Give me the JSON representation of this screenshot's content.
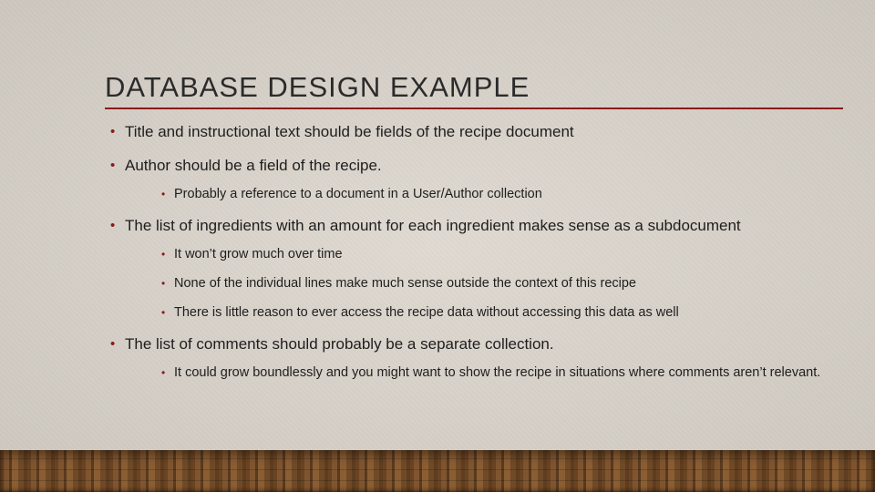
{
  "title": "DATABASE DESIGN EXAMPLE",
  "bullets": [
    {
      "text": "Title and instructional text should be fields of the recipe document",
      "sub": []
    },
    {
      "text": "Author should be a field of the recipe.",
      "sub": [
        "Probably a reference to a document in a User/Author collection"
      ]
    },
    {
      "text": "The list of ingredients with an amount for each ingredient makes sense as a subdocument",
      "sub": [
        "It won’t grow much over time",
        "None of the individual lines make much sense outside the context of this recipe",
        "There is little reason to ever access the recipe data without accessing this data as well"
      ]
    },
    {
      "text": "The list of comments should probably be a separate collection.",
      "sub": [
        "It could grow boundlessly and you might want to show the recipe in situations where comments aren’t relevant."
      ]
    }
  ]
}
